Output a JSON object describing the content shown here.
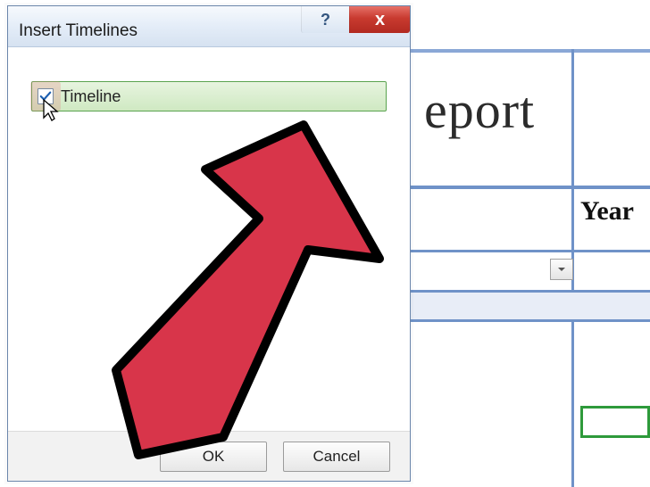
{
  "sheet": {
    "visible_title_fragment": "eport",
    "column_header": "Year"
  },
  "dialog": {
    "title": "Insert Timelines",
    "help_symbol": "?",
    "close_symbol": "x",
    "fields": [
      {
        "label": "Timeline",
        "checked": true
      }
    ],
    "buttons": {
      "ok": "OK",
      "cancel": "Cancel"
    }
  }
}
